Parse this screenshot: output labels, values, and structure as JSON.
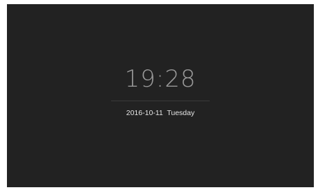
{
  "lock_screen": {
    "time": "19:28",
    "date": "2016-10-11",
    "weekday": "Tuesday"
  }
}
